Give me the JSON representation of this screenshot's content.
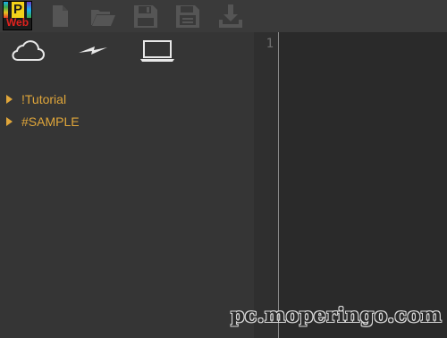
{
  "app": {
    "logo_letter": "P",
    "logo_word": "Web"
  },
  "toolbar": {
    "icons": [
      "new-file-icon",
      "open-folder-icon",
      "save-icon",
      "save-as-icon",
      "download-icon"
    ]
  },
  "sidebar": {
    "tabs": [
      "cloud-icon",
      "lightning-icon",
      "laptop-icon"
    ],
    "tree": [
      {
        "label": "!Tutorial"
      },
      {
        "label": "#SAMPLE"
      }
    ]
  },
  "editor": {
    "line_numbers": [
      "1"
    ]
  },
  "watermark": "pc.moperingo.com",
  "colors": {
    "tree_text": "#e0a63a",
    "toolbar_bg": "#3a3a3a",
    "sidebar_bg": "#353535",
    "editor_bg": "#2a2a2a"
  }
}
